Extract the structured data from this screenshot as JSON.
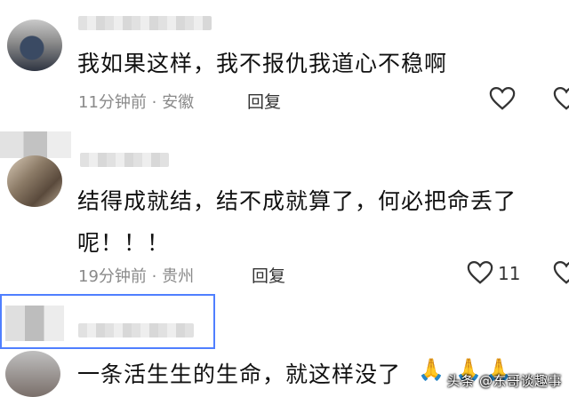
{
  "comments": [
    {
      "text": "我如果这样，我不报仇我道心不稳啊",
      "time": "11分钟前",
      "separator": "·",
      "location": "安徽",
      "reply_label": "回复"
    },
    {
      "text_line1": "结得成就结，结不成就算了，何必把命丢了",
      "text_line2": "呢！！！",
      "time": "19分钟前",
      "separator": "·",
      "location": "贵州",
      "reply_label": "回复",
      "like_count": "11"
    },
    {
      "text": "一条活生生的生命，就这样没了",
      "emoji": "🙏"
    }
  ],
  "watermark": "头条 @东哥谈趣事",
  "colors": {
    "highlight_border": "#4f7fff",
    "meta_text": "#8a8a8a"
  },
  "icons": [
    "heart-icon",
    "prayer-hands-emoji"
  ]
}
